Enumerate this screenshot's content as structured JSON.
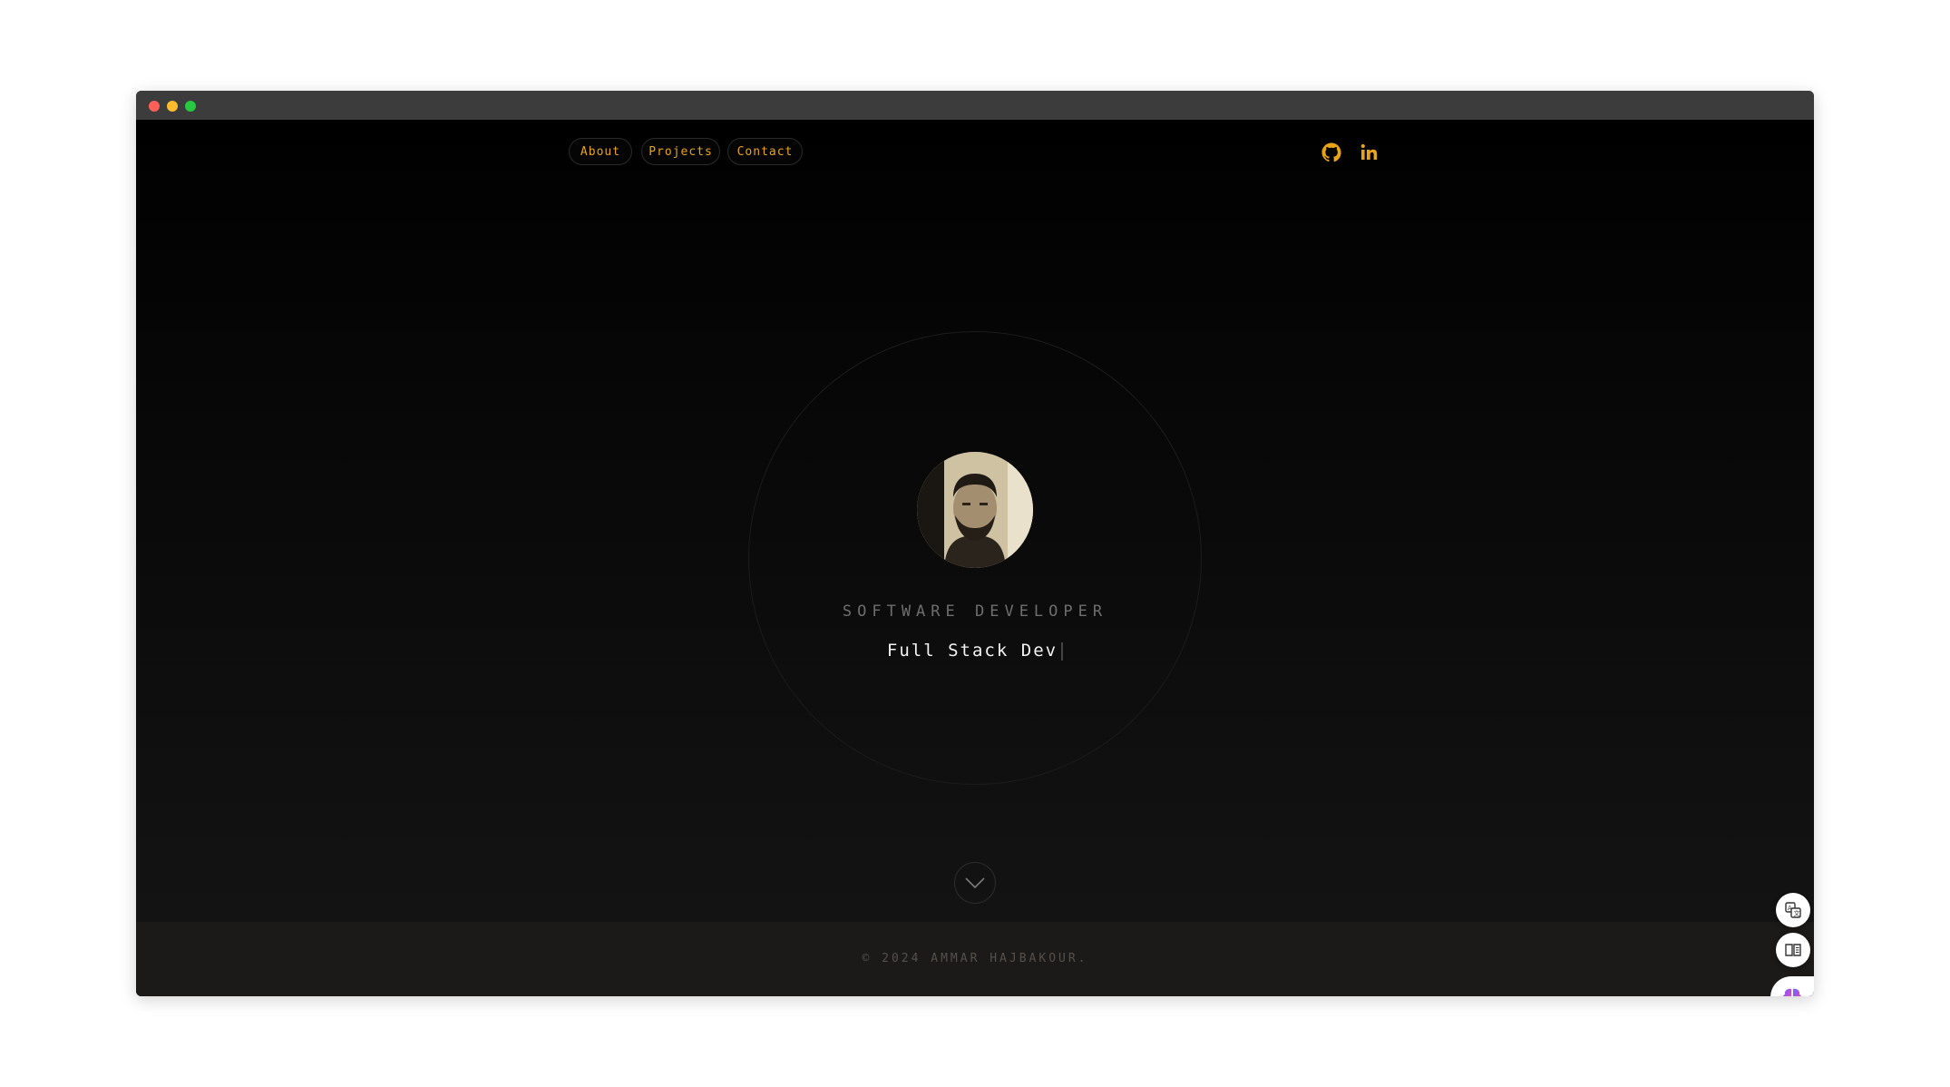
{
  "nav": {
    "about": "About",
    "projects": "Projects",
    "contact": "Contact"
  },
  "social": {
    "icons": [
      "github-icon",
      "linkedin-icon"
    ]
  },
  "hero": {
    "role": "SOFTWARE DEVELOPER",
    "typing_text": "Full Stack Dev"
  },
  "footer": {
    "copyright": "© 2024 AMMAR HAJBAKOUR."
  },
  "colors": {
    "accent": "#e8a317",
    "background": "#000000",
    "footer_bg": "#1c1a19"
  }
}
